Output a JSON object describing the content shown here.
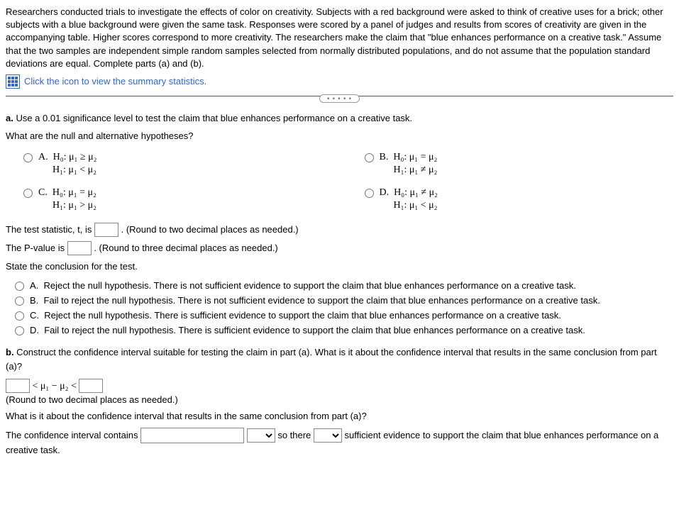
{
  "intro": "Researchers conducted trials to investigate the effects of color on creativity. Subjects with a red background were asked to think of creative uses for a brick; other subjects with a blue background were given the same task. Responses were scored by a panel of judges and results from scores of creativity are given in the accompanying table. Higher scores correspond to more creativity. The researchers make the claim that \"blue enhances performance on a creative task.\" Assume that the two samples are independent simple random samples selected from normally distributed populations, and do not assume that the population standard deviations are equal. Complete parts (a) and (b).",
  "summary_link": "Click the icon to view the summary statistics.",
  "part_a": {
    "prompt_bold": "a.",
    "prompt": " Use a 0.01 significance level to test the claim that blue enhances performance on a creative task.",
    "hyp_q": "What are the null and alternative hypotheses?",
    "options": {
      "A": {
        "label": "A.",
        "h0": "H₀: μ₁ ≥ μ₂",
        "h1": "H₁: μ₁ < μ₂"
      },
      "B": {
        "label": "B.",
        "h0": "H₀: μ₁ = μ₂",
        "h1": "H₁: μ₁ ≠ μ₂"
      },
      "C": {
        "label": "C.",
        "h0": "H₀: μ₁ = μ₂",
        "h1": "H₁: μ₁ > μ₂"
      },
      "D": {
        "label": "D.",
        "h0": "H₀: μ₁ ≠ μ₂",
        "h1": "H₁: μ₁ < μ₂"
      }
    },
    "tstat_pre": "The test statistic, t, is ",
    "tstat_post": ". (Round to two decimal places as needed.)",
    "pval_pre": "The P-value is ",
    "pval_post": ". (Round to three decimal places as needed.)",
    "conclusion_q": "State the conclusion for the test.",
    "concl_opts": {
      "A": {
        "label": "A.",
        "text": "Reject the null hypothesis. There is not sufficient evidence to support the claim that blue enhances performance on a creative task."
      },
      "B": {
        "label": "B.",
        "text": "Fail to reject the null hypothesis. There is not sufficient evidence to support the claim that blue enhances performance on a creative task."
      },
      "C": {
        "label": "C.",
        "text": "Reject the null hypothesis. There is sufficient evidence to support the claim that blue enhances performance on a creative task."
      },
      "D": {
        "label": "D.",
        "text": "Fail to reject the null hypothesis. There is sufficient evidence to support the claim that blue enhances performance on a creative task."
      }
    }
  },
  "part_b": {
    "prompt_bold": "b.",
    "prompt": " Construct the confidence interval suitable for testing the claim in part (a). What is it about the confidence interval that results in the same conclusion from part (a)?",
    "ci_mid": " < μ₁ − μ₂ < ",
    "round_note": "(Round to two decimal places as needed.)",
    "followup": "What is it about the confidence interval that results in the same conclusion from part (a)?",
    "sentence_pre": "The confidence interval contains ",
    "sentence_mid": " so there ",
    "sentence_post": " sufficient evidence to support the claim that blue enhances performance on a creative task."
  }
}
